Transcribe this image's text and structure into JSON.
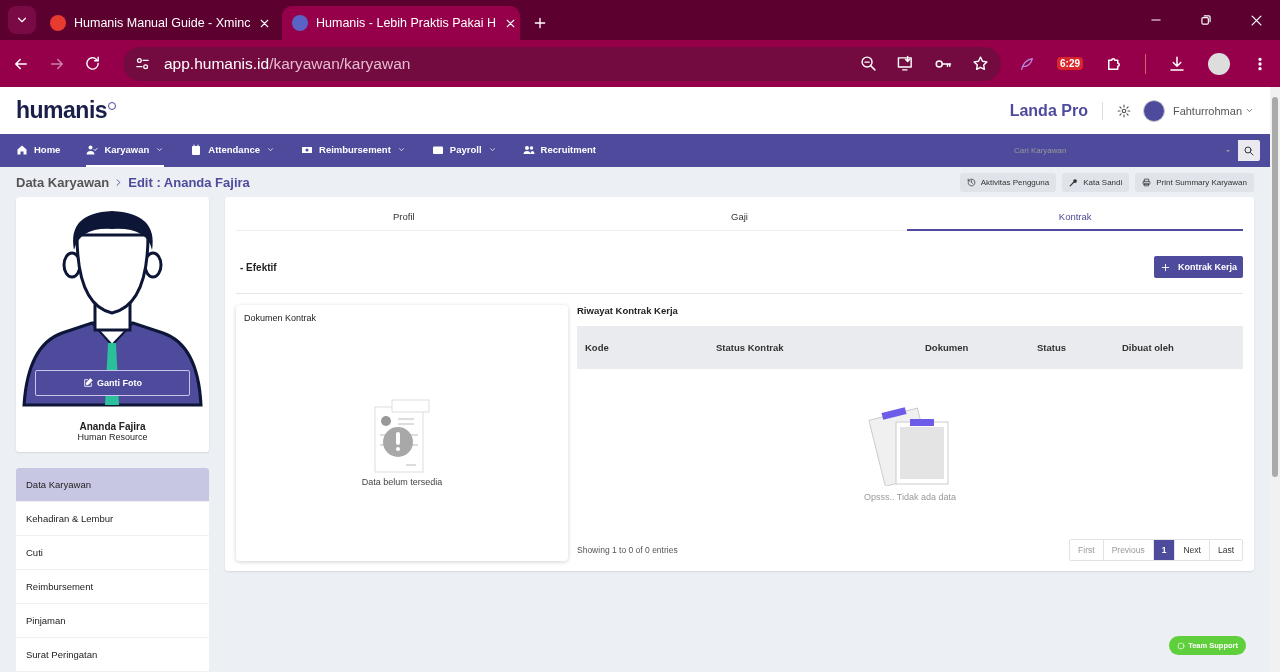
{
  "browser": {
    "tabs": [
      {
        "title": "Humanis Manual Guide - Xminc",
        "selected": false
      },
      {
        "title": "Humanis - Lebih Praktis Pakai H",
        "selected": true
      }
    ],
    "url_host": "app.humanis.id",
    "url_path": "/karyawan/karyawan",
    "extension_badge": "6:29"
  },
  "header": {
    "logo": "humanis",
    "company": "Landa Pro",
    "user": "Fahturrohman"
  },
  "nav": {
    "items": [
      {
        "label": "Home",
        "dropdown": false,
        "selected": false
      },
      {
        "label": "Karyawan",
        "dropdown": true,
        "selected": true
      },
      {
        "label": "Attendance",
        "dropdown": true,
        "selected": false
      },
      {
        "label": "Reimbursement",
        "dropdown": true,
        "selected": false
      },
      {
        "label": "Payroll",
        "dropdown": true,
        "selected": false
      },
      {
        "label": "Recruitment",
        "dropdown": false,
        "selected": false
      }
    ],
    "search_placeholder": "Cari Karyawan"
  },
  "breadcrumb": [
    "Data Karyawan",
    "Edit : Ananda Fajira"
  ],
  "actions": [
    {
      "label": "Aktivitas Pengguna"
    },
    {
      "label": "Kata Sandi"
    },
    {
      "label": "Print Summary Karyawan"
    }
  ],
  "profile": {
    "name": "Ananda Fajira",
    "role": "Human Resource",
    "photo_button": "Ganti Foto"
  },
  "side_menu": [
    {
      "label": "Data Karyawan",
      "selected": true
    },
    {
      "label": "Kehadiran & Lembur",
      "selected": false
    },
    {
      "label": "Cuti",
      "selected": false
    },
    {
      "label": "Reimbursement",
      "selected": false
    },
    {
      "label": "Pinjaman",
      "selected": false
    },
    {
      "label": "Surat Peringatan",
      "selected": false
    }
  ],
  "tabs": [
    {
      "label": "Profil",
      "selected": false
    },
    {
      "label": "Gaji",
      "selected": false
    },
    {
      "label": "Kontrak",
      "selected": true
    }
  ],
  "section": {
    "title": "- Efektif",
    "add_button": "Kontrak Kerja"
  },
  "document_panel": {
    "title": "Dokumen Kontrak",
    "empty_text": "Data belum tersedia"
  },
  "history": {
    "title": "Riwayat Kontrak Kerja",
    "columns": [
      "Kode",
      "Status Kontrak",
      "Dokumen",
      "Status",
      "Dibuat oleh"
    ],
    "empty_text": "Opsss.. Tidak ada data",
    "info": "Showing 1 to 0 of 0 entries",
    "pagination": [
      {
        "label": "First",
        "disabled": true,
        "selected": false
      },
      {
        "label": "Previous",
        "disabled": true,
        "selected": false
      },
      {
        "label": "1",
        "disabled": false,
        "selected": true
      },
      {
        "label": "Next",
        "disabled": false,
        "selected": false
      },
      {
        "label": "Last",
        "disabled": false,
        "selected": false
      }
    ]
  },
  "support_button": "Team Support"
}
